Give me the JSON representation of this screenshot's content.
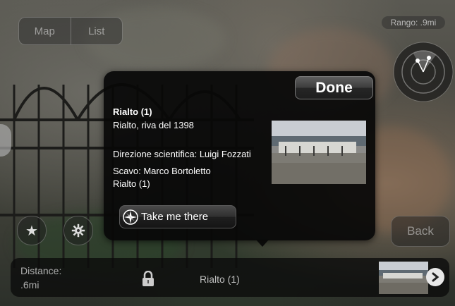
{
  "view_toggle": {
    "map_label": "Map",
    "list_label": "List"
  },
  "range_label": "Rango: .9mi",
  "popup": {
    "done_label": "Done",
    "title": "Rialto (1)",
    "subtitle": "Rialto, riva del 1398",
    "line_direction": "Direzione scientifica: Luigi Fozzati",
    "line_excavation": "Scavo: Marco Bortoletto",
    "line_name": "Rialto (1)",
    "take_me_label": "Take me there"
  },
  "side_buttons": {
    "favorite_icon": "star-icon",
    "settings_icon": "gear-icon",
    "back_label": "Back"
  },
  "bottom_bar": {
    "distance_label": "Distance:",
    "distance_value": ".6mi",
    "title": "Rialto (1)",
    "lock_icon": "lock-icon",
    "next_icon": "chevron-right-icon"
  }
}
